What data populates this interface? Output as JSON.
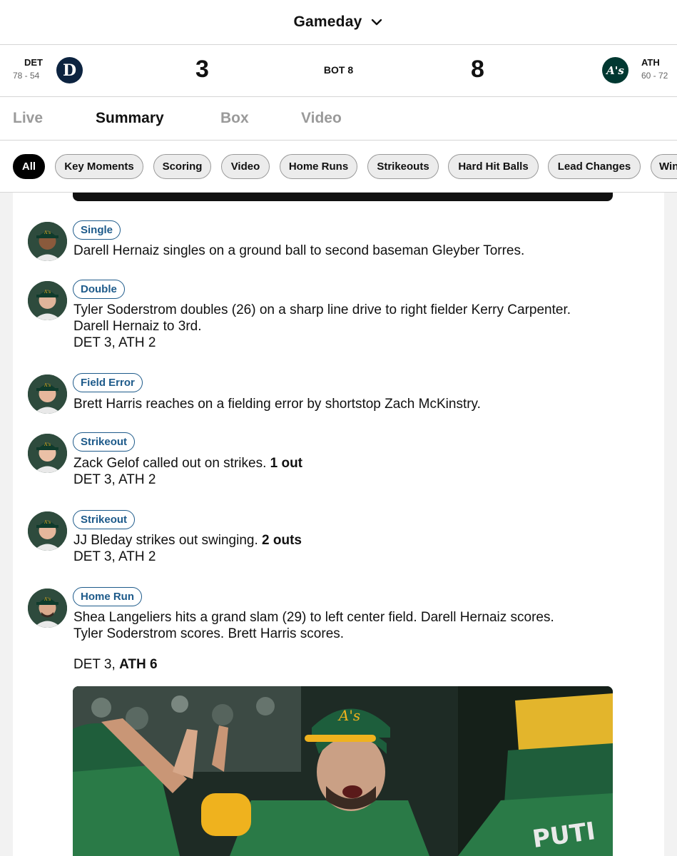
{
  "header": {
    "title": "Gameday",
    "chevron_icon": "chevron-down-icon"
  },
  "scoreboard": {
    "away": {
      "abbr": "DET",
      "record": "78 - 54",
      "score": "3",
      "logo_glyph": "D",
      "color": "#0c2340"
    },
    "home": {
      "abbr": "ATH",
      "record": "60 - 72",
      "score": "8",
      "logo_glyph": "A's",
      "color": "#003831"
    },
    "inning": "BOT 8"
  },
  "tabs": [
    "Live",
    "Summary",
    "Box",
    "Video"
  ],
  "active_tab": "Summary",
  "filters": [
    "All",
    "Key Moments",
    "Scoring",
    "Video",
    "Home Runs",
    "Strikeouts",
    "Hard Hit Balls",
    "Lead Changes",
    "Win"
  ],
  "active_filter": "All",
  "plays": [
    {
      "badge": "Single",
      "text": "Darell Hernaiz singles on a ground ball to second baseman Gleyber Torres."
    },
    {
      "badge": "Double",
      "text_line1": "Tyler Soderstrom doubles (26) on a sharp line drive to right fielder Kerry Carpenter.",
      "text_line2": "Darell Hernaiz to 3rd.",
      "score": "DET 3, ATH 2"
    },
    {
      "badge": "Field Error",
      "text": "Brett Harris reaches on a fielding error by shortstop Zach McKinstry."
    },
    {
      "badge": "Strikeout",
      "text": "Zack Gelof called out on strikes.",
      "outs": "1 out",
      "score": "DET 3, ATH 2"
    },
    {
      "badge": "Strikeout",
      "text": "JJ Bleday strikes out swinging.",
      "outs": "2 outs",
      "score": "DET 3, ATH 2"
    },
    {
      "badge": "Home Run",
      "text_line1": "Shea Langeliers hits a grand slam (29) to left center field. Darell Hernaiz scores.",
      "text_line2": "Tyler Soderstrom scores. Brett Harris scores.",
      "score_prefix": "DET 3,",
      "score_bold": "ATH 6"
    }
  ],
  "colors": {
    "badge": "#1d5a8a",
    "athletics_green": "#003831",
    "athletics_gold": "#efb21e"
  }
}
